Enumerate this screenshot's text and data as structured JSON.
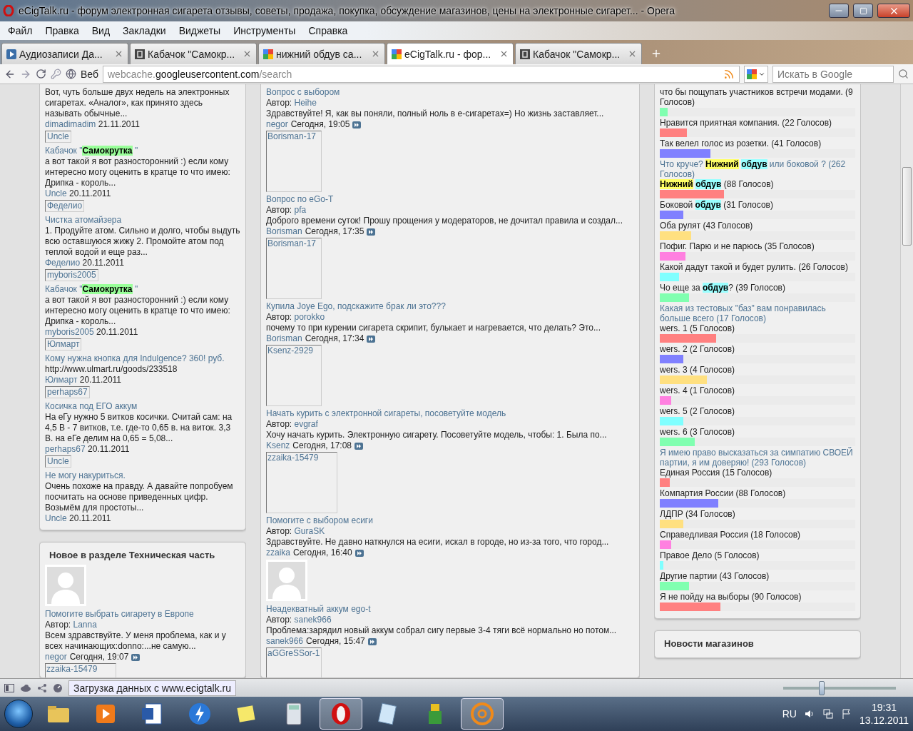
{
  "window": {
    "title": "eCigTalk.ru - форум электронная сигарета отзывы, советы, продажа, покупка, обсуждение магазинов, цены на электронные сигарет... - Opera"
  },
  "menu": [
    "Файл",
    "Правка",
    "Вид",
    "Закладки",
    "Виджеты",
    "Инструменты",
    "Справка"
  ],
  "tabs": [
    {
      "label": "Аудиозаписи Да...",
      "kind": "play",
      "selected": false
    },
    {
      "label": "Кабачок \"Самокр...",
      "kind": "letter",
      "selected": false
    },
    {
      "label": "нижний обдув са...",
      "kind": "google",
      "selected": false
    },
    {
      "label": "eCigTalk.ru - фор...",
      "kind": "google",
      "selected": true
    },
    {
      "label": "Кабачок \"Самокр...",
      "kind": "letter",
      "selected": false
    }
  ],
  "address_bar": {
    "search_engine": "Веб",
    "url": {
      "prefix": "webcache.",
      "domain": "googleusercontent.com",
      "path": "/search"
    },
    "search_placeholder": "Искать в Google"
  },
  "left_column": {
    "entries": [
      {
        "kind": "post",
        "excerpt": "Вот, чуть больше двух недель на электронных сигаретах. «Аналог», как принято здесь называть обычные...",
        "author": "dimadimadim",
        "date": "21.11.2011"
      },
      {
        "kind": "user_box",
        "label": "Uncle"
      },
      {
        "kind": "post",
        "title": [
          {
            "text": "Кабачок \""
          },
          {
            "text": "Самокрутка",
            "color": "#99ff99"
          },
          {
            "text": " \""
          }
        ],
        "excerpt": "а вот такой я вот разносторонний :) если кому интересно могу оценить в кратце то что имею: Дрипка - король...",
        "author": "Uncle",
        "date": "20.11.2011"
      },
      {
        "kind": "user_box",
        "label": "Феделио"
      },
      {
        "kind": "post",
        "title": [
          {
            "text": "Чистка атомайзера"
          }
        ],
        "excerpt": "1. Продуйте атом. Сильно и долго, чтобы выдуть всю оставшуюся жижу 2. Промойте атом под теплой водой и еще раз...",
        "author": "Феделио",
        "date": "20.11.2011"
      },
      {
        "kind": "user_box",
        "label": "myboris2005"
      },
      {
        "kind": "post",
        "title": [
          {
            "text": "Кабачок \""
          },
          {
            "text": "Самокрутка",
            "color": "#99ff99"
          },
          {
            "text": " \""
          }
        ],
        "excerpt": "а вот такой я вот разносторонний :) если кому интересно могу оценить в кратце то что имею: Дрипка - король...",
        "author": "myboris2005",
        "date": "20.11.2011"
      },
      {
        "kind": "user_box",
        "label": "Юлмарт"
      },
      {
        "kind": "post",
        "title": [
          {
            "text": "Кому нужна кнопка для Indulgence? 360! руб."
          }
        ],
        "excerpt": "http://www.ulmart.ru/goods/233518",
        "author": "Юлмарт",
        "date": "20.11.2011"
      },
      {
        "kind": "user_box",
        "label": "perhaps67"
      },
      {
        "kind": "post",
        "title": [
          {
            "text": "Косичка под ЕГО аккум"
          }
        ],
        "excerpt": "На еГу нужно 5 витков косички. Считай сам: на 4,5 В - 7 витков, т.е. где-то 0,65 в. на виток. 3,3 В. на еГе делим на 0,65 = 5,08...",
        "author": "perhaps67",
        "date": "20.11.2011"
      },
      {
        "kind": "user_box",
        "label": "Uncle"
      },
      {
        "kind": "post",
        "title": [
          {
            "text": "Не могу накуриться."
          }
        ],
        "excerpt": "Очень похоже на правду. А давайте попробуем посчитать на основе приведенных цифр. Возьмём для простоты...",
        "author": "Uncle",
        "date": "20.11.2011"
      }
    ]
  },
  "tech_section": {
    "title": "Новое в разделе Техническая часть",
    "entries": [
      {
        "kind": "default_avatar"
      },
      {
        "kind": "topic",
        "title": "Помогите выбрать сигарету в Европе",
        "author_label": "Автор:",
        "author": "Lanna",
        "excerpt": "Всем здравствуйте. У меня проблема, как и у всех начинающих:donno:...не самую...",
        "last_user": "negor",
        "time": "Сегодня, 19:07"
      },
      {
        "kind": "broken_avatar",
        "label": "zzaika-15479"
      }
    ]
  },
  "middle_column": {
    "entries": [
      {
        "kind": "topic",
        "title": "Вопрос с выбором",
        "author_label": "Автор:",
        "author": "Heihe",
        "excerpt": "Здравствуйте! Я, как вы поняли, полный ноль в е-сигаретах=) Но жизнь заставляет...",
        "last_user": "negor",
        "time": "Сегодня, 19:05"
      },
      {
        "kind": "broken_avatar",
        "label": "Borisman-17"
      },
      {
        "kind": "topic",
        "title": "Вопрос по eGo-T",
        "author_label": "Автор:",
        "author": "pfa",
        "excerpt": "Доброго времени суток! Прошу прощения у модераторов, не дочитал правила и создал...",
        "last_user": "Borisman",
        "time": "Сегодня, 17:35"
      },
      {
        "kind": "broken_avatar",
        "label": "Borisman-17"
      },
      {
        "kind": "topic",
        "title": "Купила Joye Ego, подскажите брак ли это???",
        "author_label": "Автор:",
        "author": "porokko",
        "excerpt": "почему то при курении сигарета скрипит, булькает и нагревается, что делать? Это...",
        "last_user": "Borisman",
        "time": "Сегодня, 17:34"
      },
      {
        "kind": "broken_avatar",
        "label": "Ksenz-2929"
      },
      {
        "kind": "topic",
        "title": "Начать курить с электронной сигареты, посоветуйте модель",
        "author_label": "Автор:",
        "author": "evgraf",
        "excerpt": "Хочу начать курить. Электронную сигарету. Посоветуйте модель, чтобы: 1. Была по...",
        "last_user": "Ksenz",
        "time": "Сегодня, 17:08"
      },
      {
        "kind": "broken_avatar",
        "label": "zzaika-15479"
      },
      {
        "kind": "topic",
        "title": "Помогите с выбором есиги",
        "author_label": "Автор:",
        "author": "GuraSK",
        "excerpt": "Здравствуйте. Не давно наткнулся на есиги, искал в городе, но из-за того, что город...",
        "last_user": "zzaika",
        "time": "Сегодня, 16:40"
      },
      {
        "kind": "default_avatar"
      },
      {
        "kind": "topic",
        "title": "Неадекватный аккум ego-t",
        "author_label": "Автор:",
        "author": "sanek966",
        "excerpt": "Проблема:зарядил новый аккум собрал сигу первые 3-4 тяги всё нормально но потом...",
        "last_user": "sanek966",
        "time": "Сегодня, 15:47"
      },
      {
        "kind": "broken_avatar",
        "label": "aGGreSSor-1"
      }
    ]
  },
  "polls": [
    {
      "options": [
        {
          "label": [
            {
              "text": "что бы пощупать участников встречи модами. (9 Голосов)"
            }
          ],
          "level": 0.04,
          "color": "#80ffb0"
        },
        {
          "label": [
            {
              "text": "Нравится приятная компания. (22 Голосов)"
            }
          ],
          "level": 0.14,
          "color": "#ff8080"
        },
        {
          "label": [
            {
              "text": "Так велел голос из розетки. (41 Голосов)"
            }
          ],
          "level": 0.26,
          "color": "#8080ff"
        }
      ]
    },
    {
      "question": [
        {
          "text": "Что круче? "
        },
        {
          "text": "Нижний",
          "color": "#ffff66"
        },
        {
          "text": "обдув",
          "color": "#99ffff"
        },
        {
          "text": " или боковой ? (262 Голосов)"
        }
      ],
      "options": [
        {
          "label": [
            {
              "text": "Нижний",
              "color": "#ffff66"
            },
            {
              "text": "обдув",
              "color": "#99ffff"
            },
            {
              "text": " (88 Голосов)"
            }
          ],
          "level": 0.33,
          "color": "#ff8080"
        },
        {
          "label": [
            {
              "text": "Боковой "
            },
            {
              "text": "обдув",
              "color": "#99ffff"
            },
            {
              "text": " (31 Голосов)"
            }
          ],
          "level": 0.12,
          "color": "#8080ff"
        },
        {
          "label": [
            {
              "text": "Оба рулят (43 Голосов)"
            }
          ],
          "level": 0.16,
          "color": "#ffe080"
        },
        {
          "label": [
            {
              "text": "Пофиг. Парю и не парюсь (35 Голосов)"
            }
          ],
          "level": 0.13,
          "color": "#ff80e0"
        },
        {
          "label": [
            {
              "text": "Какой дадут такой и будет рулить. (26 Голосов)"
            }
          ],
          "level": 0.1,
          "color": "#80ffff"
        },
        {
          "label": [
            {
              "text": "Чо еще за "
            },
            {
              "text": "обдув",
              "color": "#99ffff"
            },
            {
              "text": "? (39 Голосов)"
            }
          ],
          "level": 0.15,
          "color": "#80ffb0"
        }
      ]
    },
    {
      "question": [
        {
          "text": "Какая из тестовых \"баз\" вам понравилась больше всего (17 Голосов)"
        }
      ],
      "options": [
        {
          "label": [
            {
              "text": "wers. 1 (5 Голосов)"
            }
          ],
          "level": 0.29,
          "color": "#ff8080"
        },
        {
          "label": [
            {
              "text": "wers. 2 (2 Голосов)"
            }
          ],
          "level": 0.12,
          "color": "#8080ff"
        },
        {
          "label": [
            {
              "text": "wers. 3 (4 Голосов)"
            }
          ],
          "level": 0.24,
          "color": "#ffe080"
        },
        {
          "label": [
            {
              "text": "wers. 4 (1 Голосов)"
            }
          ],
          "level": 0.06,
          "color": "#ff80e0"
        },
        {
          "label": [
            {
              "text": "wers. 5 (2 Голосов)"
            }
          ],
          "level": 0.12,
          "color": "#80ffff"
        },
        {
          "label": [
            {
              "text": "wers. 6 (3 Голосов)"
            }
          ],
          "level": 0.18,
          "color": "#80ffb0"
        }
      ]
    },
    {
      "question": [
        {
          "text": "Я имею право высказаться за симпатию СВОЕЙ партии, я им доверяю! (293 Голосов)"
        }
      ],
      "options": [
        {
          "label": [
            {
              "text": "Единая Россия (15 Голосов)"
            }
          ],
          "level": 0.05,
          "color": "#ff8080"
        },
        {
          "label": [
            {
              "text": "Компартия России (88 Голосов)"
            }
          ],
          "level": 0.3,
          "color": "#8080ff"
        },
        {
          "label": [
            {
              "text": "ЛДПР (34 Голосов)"
            }
          ],
          "level": 0.12,
          "color": "#ffe080"
        },
        {
          "label": [
            {
              "text": "Справедливая Россия (18 Голосов)"
            }
          ],
          "level": 0.06,
          "color": "#ff80e0"
        },
        {
          "label": [
            {
              "text": "Правое Дело (5 Голосов)"
            }
          ],
          "level": 0.02,
          "color": "#80ffff"
        },
        {
          "label": [
            {
              "text": "Другие партии (43 Голосов)"
            }
          ],
          "level": 0.15,
          "color": "#80ffb0"
        },
        {
          "label": [
            {
              "text": "Я не пойду на выборы (90 Голосов)"
            }
          ],
          "level": 0.31,
          "color": "#ff8080"
        }
      ]
    }
  ],
  "shop_news": {
    "title": "Новости магазинов"
  },
  "status_bar": {
    "text": "Загрузка данных с www.ecigtalk.ru",
    "zoom": {
      "level": 0.33
    }
  },
  "taskbar": {
    "apps": [
      {
        "kind": "folder",
        "active": false
      },
      {
        "kind": "media",
        "active": false
      },
      {
        "kind": "word",
        "active": false
      },
      {
        "kind": "lightning",
        "active": false
      },
      {
        "kind": "notes",
        "active": false
      },
      {
        "kind": "calculator",
        "active": false
      },
      {
        "kind": "opera",
        "active": true
      },
      {
        "kind": "notepad",
        "active": false
      },
      {
        "kind": "game",
        "active": false
      },
      {
        "kind": "mail",
        "active": true
      }
    ],
    "language": "RU",
    "time": "19:31",
    "date": "13.12.2011"
  }
}
